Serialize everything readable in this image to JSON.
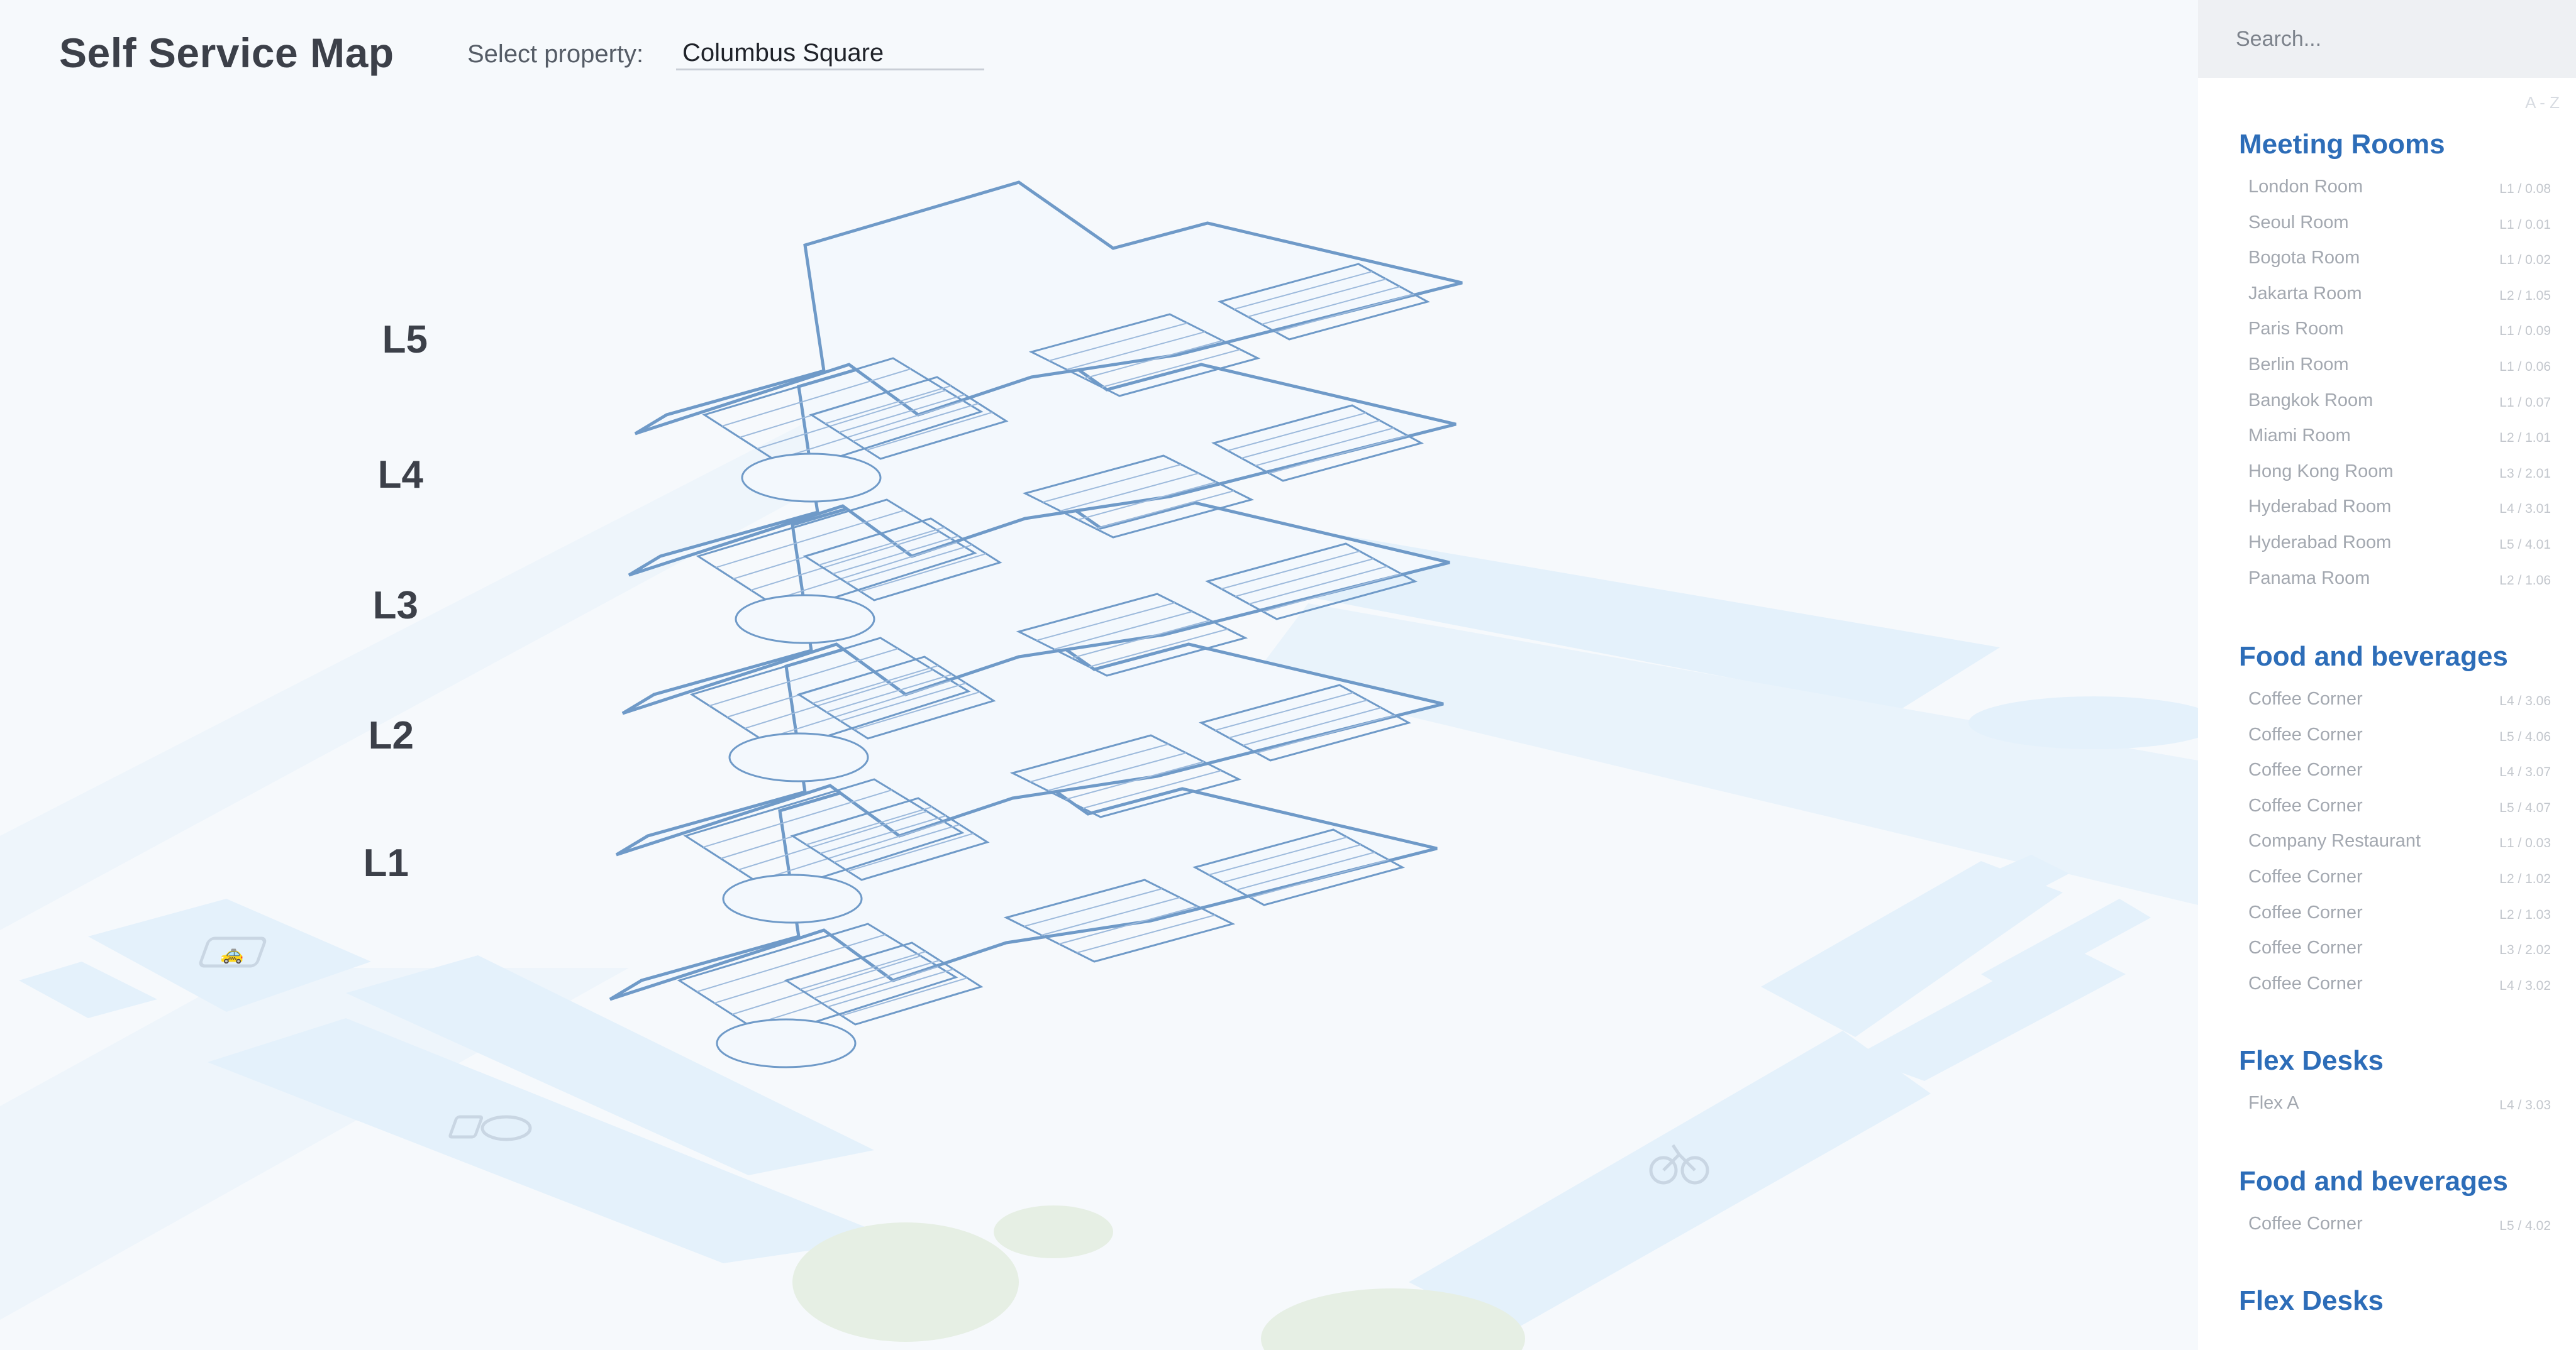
{
  "header": {
    "title": "Self Service Map",
    "property_label": "Select property:",
    "property_value": "Columbus Square"
  },
  "map": {
    "levels": [
      "L5",
      "L4",
      "L3",
      "L2",
      "L1"
    ],
    "icons": [
      "taxi-icon",
      "parking-car-icon",
      "bicycle-icon"
    ],
    "colors": {
      "road": "#e4f1fb",
      "green": "#e6efe4",
      "floor_stroke": "#6f9ac8",
      "floor_fill": "#f3f8fd"
    }
  },
  "sidebar": {
    "search_placeholder": "Search...",
    "sort_label": "A - Z",
    "groups": [
      {
        "title": "Meeting Rooms",
        "items": [
          {
            "name": "London Room",
            "code": "L1 / 0.08"
          },
          {
            "name": "Seoul Room",
            "code": "L1 / 0.01"
          },
          {
            "name": "Bogota Room",
            "code": "L1 / 0.02"
          },
          {
            "name": "Jakarta Room",
            "code": "L2 / 1.05"
          },
          {
            "name": "Paris Room",
            "code": "L1 / 0.09"
          },
          {
            "name": "Berlin Room",
            "code": "L1 / 0.06"
          },
          {
            "name": "Bangkok Room",
            "code": "L1 / 0.07"
          },
          {
            "name": "Miami Room",
            "code": "L2 / 1.01"
          },
          {
            "name": "Hong Kong Room",
            "code": "L3 / 2.01"
          },
          {
            "name": "Hyderabad Room",
            "code": "L4 / 3.01"
          },
          {
            "name": "Hyderabad Room",
            "code": "L5 / 4.01"
          },
          {
            "name": "Panama Room",
            "code": "L2 / 1.06"
          }
        ]
      },
      {
        "title": "Food and beverages",
        "items": [
          {
            "name": "Coffee Corner",
            "code": "L4 / 3.06"
          },
          {
            "name": "Coffee Corner",
            "code": "L5 / 4.06"
          },
          {
            "name": "Coffee Corner",
            "code": "L4 / 3.07"
          },
          {
            "name": "Coffee Corner",
            "code": "L5 / 4.07"
          },
          {
            "name": "Company Restaurant",
            "code": "L1 / 0.03"
          },
          {
            "name": "Coffee Corner",
            "code": "L2 / 1.02"
          },
          {
            "name": "Coffee Corner",
            "code": "L2 / 1.03"
          },
          {
            "name": "Coffee Corner",
            "code": "L3 / 2.02"
          },
          {
            "name": "Coffee Corner",
            "code": "L4 / 3.02"
          }
        ]
      },
      {
        "title": "Flex Desks",
        "items": [
          {
            "name": "Flex A",
            "code": "L4 / 3.03"
          }
        ]
      },
      {
        "title": "Food and beverages",
        "items": [
          {
            "name": "Coffee Corner",
            "code": "L5 / 4.02"
          }
        ]
      },
      {
        "title": "Flex Desks",
        "items": []
      }
    ]
  }
}
